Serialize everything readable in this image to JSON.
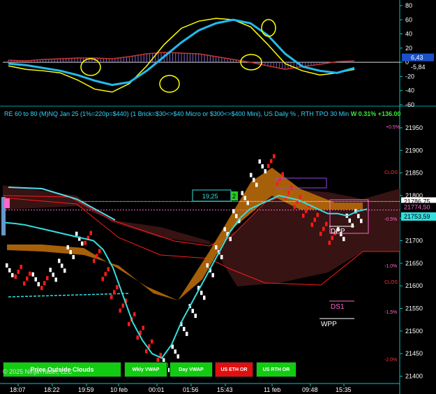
{
  "title": "RE 60 to 80 (M)NQ Jan 25 (1%=220p=$440) (1 Brick=$30<>$40 Micro or $300<>$400 Mini), US Daily % , RTH TPO 30 Min",
  "header_right_value": "W 0.31% +136.00",
  "copyright": "© 2025 NinjaTrader, LLC",
  "buttons": [
    {
      "label": "Price Outside Clouds",
      "color": "#11cc11"
    },
    {
      "label": "Wkly VWAP",
      "color": "#11cc11"
    },
    {
      "label": "Day VWAP",
      "color": "#11cc11"
    },
    {
      "label": "US ETH OR",
      "color": "#e01010"
    },
    {
      "label": "US RTH OR",
      "color": "#11cc11"
    }
  ],
  "colors": {
    "cyan": "#33e0e0",
    "yellow": "#ffff00",
    "red": "#ff1a1a",
    "white": "#ffffff",
    "orange_cloud": "#b86a0a",
    "dark_cloud": "#3a1414",
    "axis": "#00c8c8"
  },
  "chart_data": [
    {
      "type": "line",
      "panel": "oscillator",
      "ylim": [
        -60,
        80
      ],
      "yticks": [
        80,
        60,
        40,
        20,
        0,
        -20,
        -40,
        -60
      ],
      "x": [
        0,
        10,
        20,
        30,
        40,
        50,
        60,
        70,
        80,
        90,
        100,
        110,
        120,
        130,
        140,
        150,
        160,
        170,
        180,
        190,
        200
      ],
      "series": [
        {
          "role": "fast",
          "color": "#ffff00",
          "values": [
            -5,
            -10,
            -12,
            -15,
            -25,
            -38,
            -42,
            -30,
            -5,
            25,
            48,
            58,
            62,
            60,
            50,
            25,
            -2,
            -12,
            -18,
            -15,
            -10
          ]
        },
        {
          "role": "slow",
          "color": "#22bbee",
          "values": [
            -2,
            -4,
            -8,
            -12,
            -18,
            -26,
            -32,
            -28,
            -12,
            8,
            28,
            45,
            55,
            60,
            55,
            38,
            12,
            -6,
            -12,
            -15,
            -8
          ]
        },
        {
          "role": "histogram",
          "color": "#cc3333",
          "values": [
            3,
            2,
            4,
            5,
            6,
            6,
            5,
            8,
            12,
            14,
            13,
            12,
            8,
            4,
            0,
            -5,
            -10,
            -6,
            -3,
            1,
            2
          ]
        }
      ],
      "value_labels": [
        "6,43",
        "-5,84"
      ],
      "value_label_colors": [
        "#1a50c8",
        "#ffffff"
      ]
    },
    {
      "type": "line",
      "panel": "price",
      "ylim": [
        21390,
        21970
      ],
      "yticks": [
        21950,
        21900,
        21850,
        21800,
        21750,
        21700,
        21650,
        21600,
        21550,
        21500,
        21450,
        21400
      ],
      "xtick_labels": [
        "18:07",
        "18:22",
        "19:59",
        "10 feb",
        "00:01",
        "01:56",
        "15:43",
        "11 feb",
        "09:48",
        "15:35"
      ],
      "series": [
        {
          "name": "Renko",
          "values": [
            21650,
            21625,
            21610,
            21630,
            21600,
            21640,
            21660,
            21690,
            21720,
            21700,
            21660,
            21620,
            21580,
            21550,
            21520,
            21490,
            21460,
            21430,
            21440,
            21470,
            21520,
            21560,
            21600,
            21650,
            21690,
            21730,
            21770,
            21810,
            21850,
            21880,
            21870,
            21830,
            21800,
            21780,
            21760,
            21740,
            21720,
            21700,
            21730,
            21760,
            21770
          ]
        },
        {
          "name": "VWAP",
          "values": [
            21740,
            21738,
            21735,
            21730,
            21725,
            21720,
            21715,
            21710,
            21705,
            21700,
            21680,
            21640,
            21580,
            21520,
            21480,
            21450,
            21440,
            21470,
            21520,
            21560,
            21600,
            21640,
            21680,
            21720,
            21750,
            21770,
            21780,
            21790,
            21800,
            21795,
            21790,
            21780,
            21770,
            21760,
            21760,
            21755,
            21765,
            21770
          ]
        }
      ],
      "price_labels": [
        "21786,75",
        "21774,50",
        "21753,59"
      ],
      "price_label_colors": [
        "#ffffff",
        "#ff66cc",
        "#33e0e0"
      ],
      "annotations": [
        "+0.5%",
        "CLOS",
        "-0.5%",
        "-1.0%",
        "CLOS",
        "-1.5%",
        "-2.0%",
        "DPP",
        "DS1",
        "WPP",
        "19,25",
        "2"
      ]
    }
  ]
}
